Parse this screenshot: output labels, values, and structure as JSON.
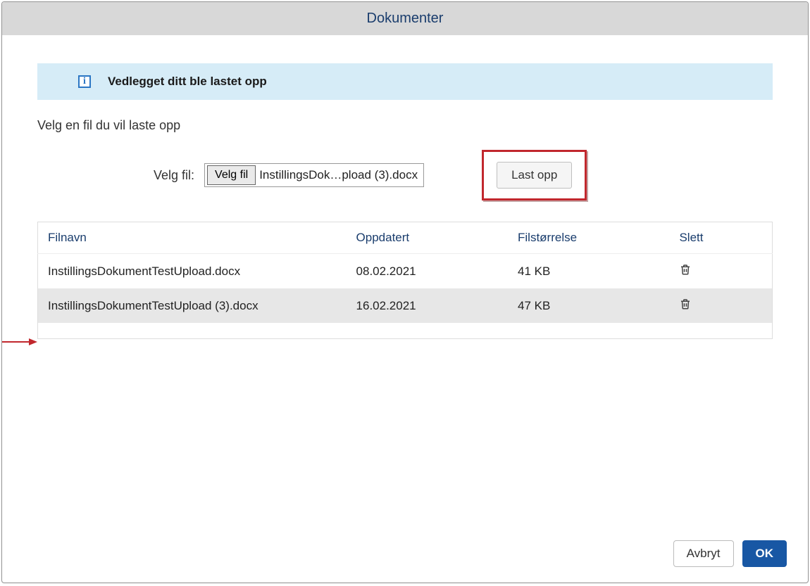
{
  "dialog": {
    "title": "Dokumenter"
  },
  "banner": {
    "icon_char": "i",
    "message": "Vedlegget ditt ble lastet opp"
  },
  "instruction": "Velg en fil du vil laste opp",
  "file_select": {
    "label": "Velg fil:",
    "button_label": "Velg fil",
    "selected_name": "InstillingsDok…pload (3).docx"
  },
  "upload_button_label": "Last opp",
  "table": {
    "headers": {
      "filename": "Filnavn",
      "updated": "Oppdatert",
      "size": "Filstørrelse",
      "delete": "Slett"
    },
    "rows": [
      {
        "filename": "InstillingsDokumentTestUpload.docx",
        "updated": "08.02.2021",
        "size": "41 KB"
      },
      {
        "filename": "InstillingsDokumentTestUpload (3).docx",
        "updated": "16.02.2021",
        "size": "47 KB"
      }
    ]
  },
  "footer": {
    "cancel": "Avbryt",
    "ok": "OK"
  }
}
